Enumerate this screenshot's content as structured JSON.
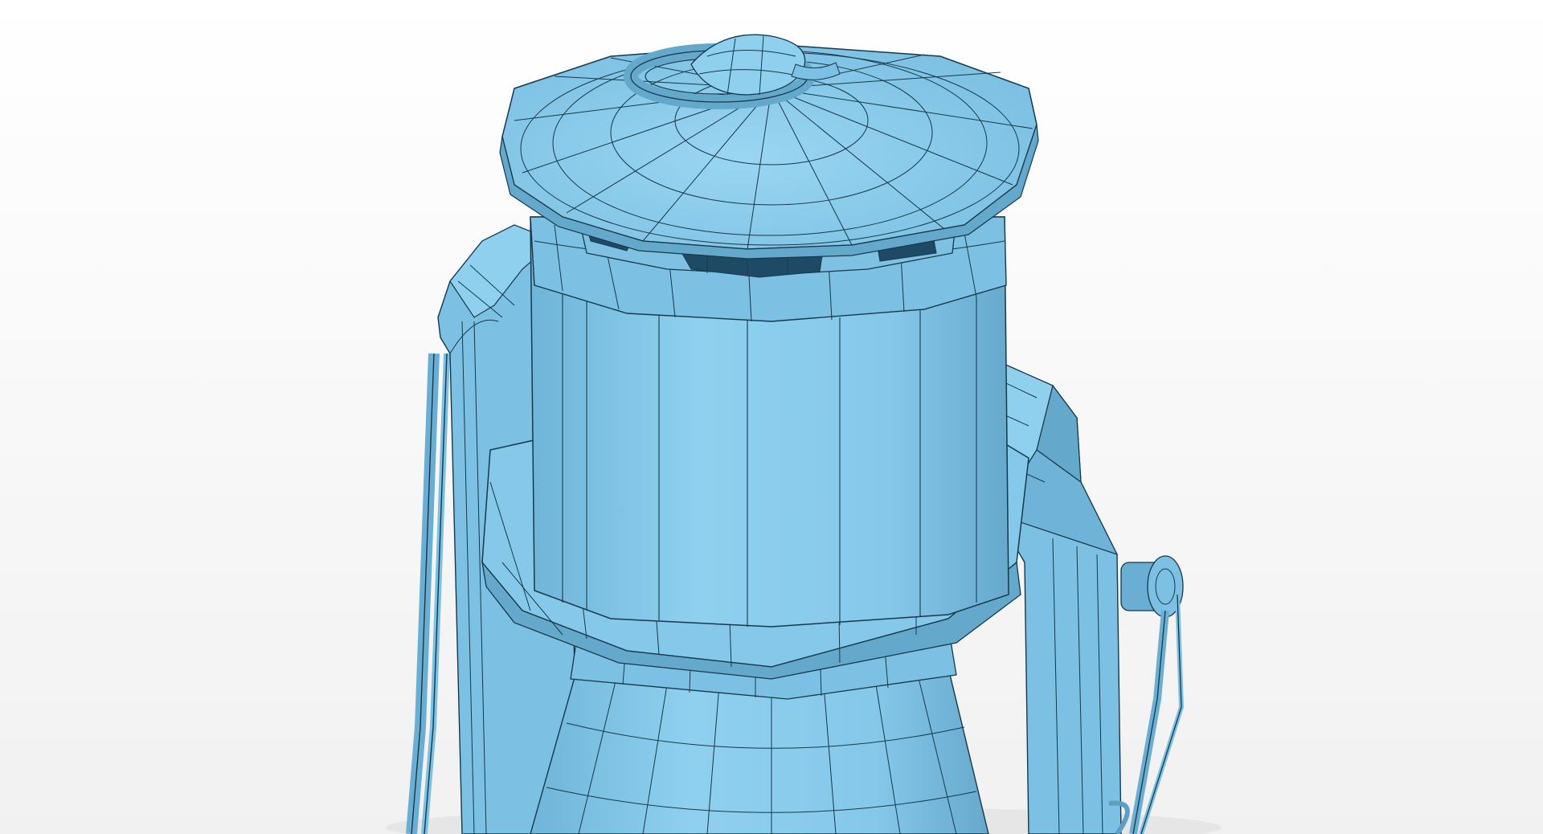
{
  "scene": {
    "subject": "lantern-wireframe-model",
    "colors": {
      "background_top": "#ffffff",
      "background_bottom": "#f1f1f1",
      "surface_light": "#8fd0ef",
      "surface_mid": "#7ec1e3",
      "surface_dark": "#64a8cc",
      "surface_shadow": "#4b8fb4",
      "wire": "#17384a",
      "vent_opening": "#1f4a66"
    }
  }
}
